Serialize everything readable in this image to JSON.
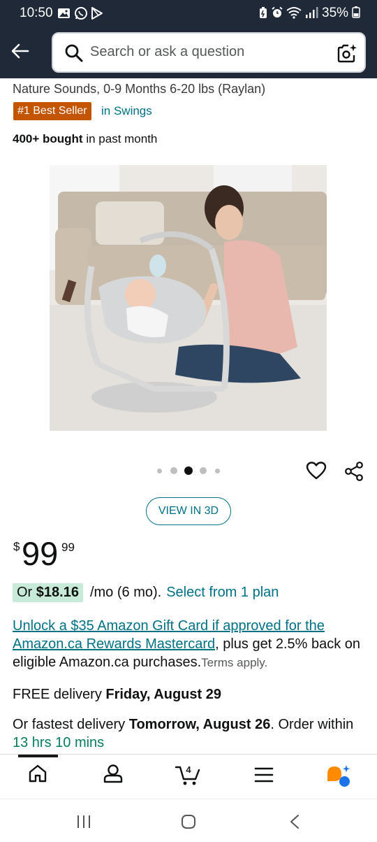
{
  "status_bar": {
    "time": "10:50",
    "battery": "35%"
  },
  "search": {
    "placeholder": "Search or ask a question"
  },
  "product": {
    "title_tail": "Nature Sounds, 0-9 Months 6-20 lbs (Raylan)",
    "badge": "#1 Best Seller",
    "badge_category": "in Swings",
    "bought_count": "400+ bought",
    "bought_suffix": " in past month",
    "image_alt": "Baby swing with infant and woman sitting on rug beside couch",
    "carousel": {
      "total_images": 5,
      "current_image": 3
    }
  },
  "actions": {
    "view_3d": "VIEW IN 3D"
  },
  "price": {
    "symbol": "$",
    "whole": "99",
    "fraction": "99"
  },
  "installment": {
    "prefix": "Or ",
    "amount": "$18.16",
    "term": "/mo (6 mo).",
    "select_plan": "Select from 1 plan"
  },
  "promo": {
    "link_text": "Unlock a $35 Amazon Gift Card if approved for the Amazon.ca Rewards Mastercard",
    "body": ", plus get 2.5% back on eligible Amazon.ca purchases.",
    "terms": "Terms apply."
  },
  "delivery": {
    "free_prefix": "FREE delivery ",
    "free_date": "Friday, August 29",
    "fastest_prefix": "Or fastest delivery ",
    "fastest_date": "Tomorrow, August 26",
    "order_within": ". Order within ",
    "countdown": "13 hrs 10 mins"
  },
  "bottom_nav": {
    "cart_count": "4",
    "items": [
      "home-icon",
      "account-icon",
      "cart-icon",
      "menu-icon",
      "rufus-assistant-icon"
    ]
  },
  "colors": {
    "header_bg": "#1f2937",
    "link": "#007185",
    "badge": "#c45500",
    "countdown": "#067d62",
    "installment_bg": "#c8ebd9"
  }
}
